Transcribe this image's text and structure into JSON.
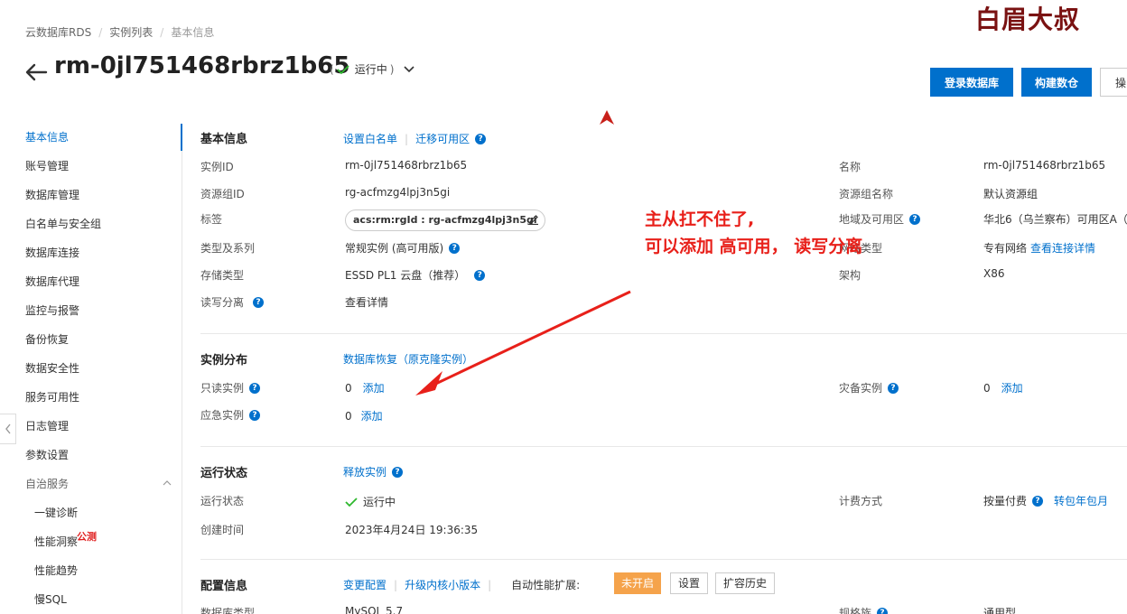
{
  "breadcrumb": [
    "云数据库RDS",
    "实例列表",
    "基本信息"
  ],
  "watermark": "白眉大叔",
  "header": {
    "title": "rm-0jl751468rbrz1b65",
    "status_text": "运行中",
    "paren_open": "(",
    "paren_close": ")",
    "buttons": {
      "login": "登录数据库",
      "build": "构建数仓",
      "more": "操"
    }
  },
  "sidebar": {
    "items": [
      "基本信息",
      "账号管理",
      "数据库管理",
      "白名单与安全组",
      "数据库连接",
      "数据库代理",
      "监控与报警",
      "备份恢复",
      "数据安全性",
      "服务可用性",
      "日志管理",
      "参数设置"
    ],
    "group": "自治服务",
    "sub_items": [
      "一键诊断",
      "性能洞察",
      "性能趋势",
      "慢SQL"
    ],
    "beta_badge": "公测"
  },
  "basic": {
    "title": "基本信息",
    "links": [
      "设置白名单",
      "迁移可用区"
    ],
    "rows_left": [
      {
        "label": "实例ID",
        "value": "rm-0jl751468rbrz1b65"
      },
      {
        "label": "资源组ID",
        "value": "rg-acfmzg4lpj3n5gi"
      },
      {
        "label": "标签",
        "value": "acs:rm:rgId : rg-acfmzg4lpj3n5gi"
      },
      {
        "label": "类型及系列",
        "value": "常规实例 (高可用版)"
      },
      {
        "label": "存储类型",
        "value": "ESSD PL1 云盘（推荐）"
      },
      {
        "label": "读写分离",
        "value": "查看详情"
      }
    ],
    "rows_right": [
      {
        "label": "名称",
        "value": "rm-0jl751468rbrz1b65"
      },
      {
        "label": "资源组名称",
        "value": "默认资源组"
      },
      {
        "label": "地域及可用区",
        "value": "华北6（乌兰察布）可用区A（"
      },
      {
        "label": "网络类型",
        "value": "专有网络",
        "link": "查看连接详情"
      },
      {
        "label": "架构",
        "value": "X86"
      }
    ]
  },
  "distribution": {
    "title": "实例分布",
    "link": "数据库恢复（原克隆实例）",
    "readonly_label": "只读实例",
    "readonly_count": "0",
    "emergency_label": "应急实例",
    "emergency_count": "0",
    "dr_label": "灾备实例",
    "dr_count": "0",
    "add": "添加"
  },
  "running": {
    "title": "运行状态",
    "link": "释放实例",
    "status_label": "运行状态",
    "status_value": "运行中",
    "created_label": "创建时间",
    "created_value": "2023年4月24日 19:36:35",
    "billing_label": "计费方式",
    "billing_value": "按量付费",
    "billing_link": "转包年包月"
  },
  "config": {
    "title": "配置信息",
    "links": [
      "变更配置",
      "升级内核小版本"
    ],
    "autoscale_label": "自动性能扩展:",
    "autoscale_state": "未开启",
    "settings_btn": "设置",
    "history_btn": "扩容历史",
    "db_type_label": "数据库类型",
    "db_type_value": "MySQL 5.7",
    "spec_family_label": "规格族",
    "spec_family_value": "通用型"
  },
  "annotation": {
    "line1": "主从扛不住了,",
    "line2": "可以添加 高可用，  读写分离"
  },
  "colors": {
    "accent": "#0070cc",
    "annotation": "#e8201a",
    "success": "#2eb82e",
    "warning": "#f5a34b"
  }
}
